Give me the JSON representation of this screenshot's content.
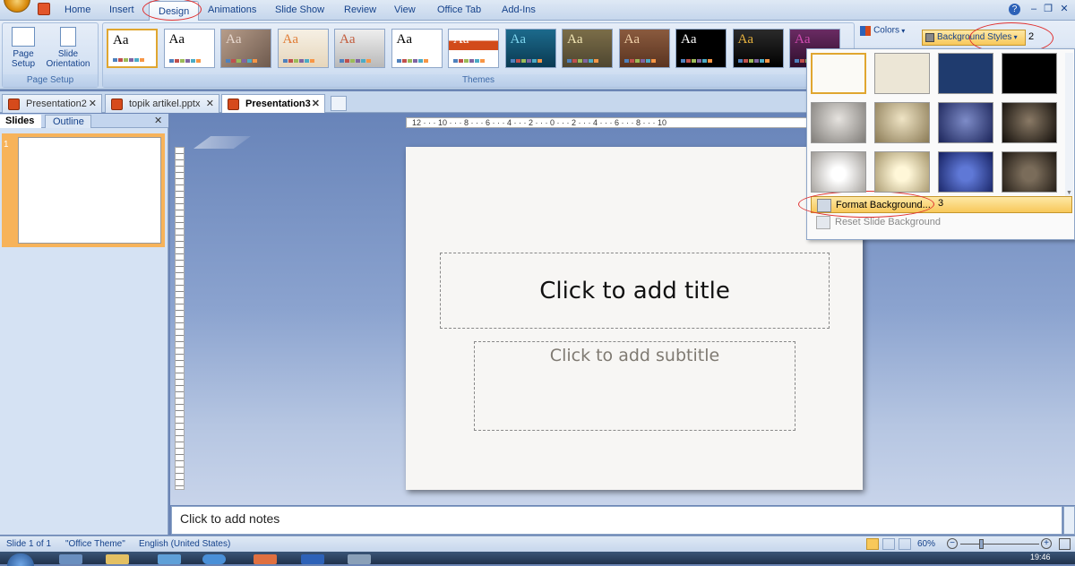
{
  "ribbon_tabs": [
    "Home",
    "Insert",
    "Design",
    "Animations",
    "Slide Show",
    "Review",
    "View",
    "Office Tab",
    "Add-Ins"
  ],
  "page_setup": {
    "page_setup_label": "Page Setup",
    "orientation_label": "Slide Orientation",
    "group_label": "Page Setup"
  },
  "themes": {
    "group_label": "Themes",
    "sample": "Aa"
  },
  "colors_label": "Colors",
  "background_styles_label": "Background Styles",
  "annotations": {
    "step2": "2",
    "step3": "3"
  },
  "doc_tabs": [
    {
      "label": "Presentation2"
    },
    {
      "label": "topik artikel.pptx"
    },
    {
      "label": "Presentation3"
    }
  ],
  "left_tabs": {
    "slides": "Slides",
    "outline": "Outline"
  },
  "slide_number": "1",
  "slide": {
    "title_placeholder": "Click to add title",
    "subtitle_placeholder": "Click to add subtitle"
  },
  "notes_placeholder": "Click to add notes",
  "ruler": {
    "h_numbers": "12 · · · 10 · · · 8 · · · 6 · · · 4 · · · 2 · · · 0 · · · 2 · · · 4 · · · 6 · · · 8 · · · 10"
  },
  "menu": {
    "format_background": "Format Background...",
    "reset_background": "Reset Slide Background"
  },
  "status": {
    "slide": "Slide 1 of 1",
    "theme": "\"Office Theme\"",
    "language": "English (United States)",
    "zoom": "60%"
  },
  "clock": "19:46",
  "colors": {
    "accent_red": "#e03030",
    "menu_highlight": "#fbd86a"
  }
}
